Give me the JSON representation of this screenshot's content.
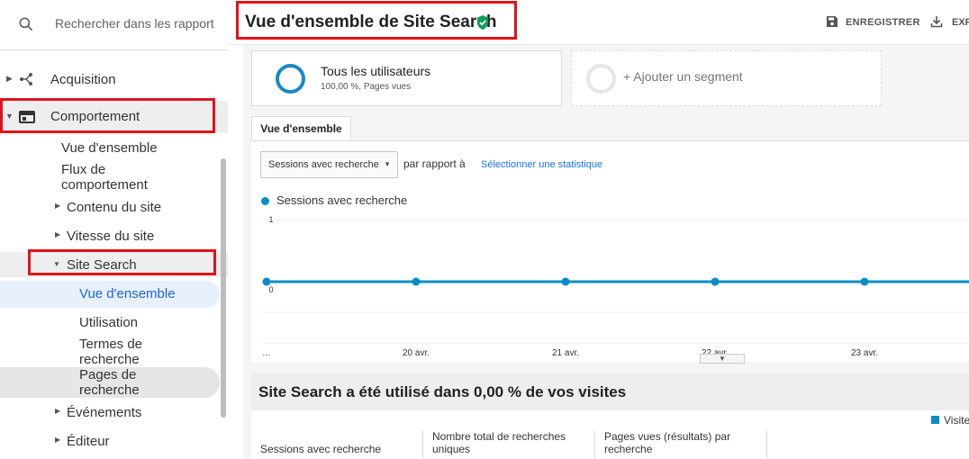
{
  "sidebar": {
    "search_placeholder": "Rechercher dans les rapport",
    "items": {
      "acquisition": "Acquisition",
      "comportement": "Comportement",
      "vue_ensemble": "Vue d'ensemble",
      "flux_comportement": "Flux de comportement",
      "contenu_site": "Contenu du site",
      "vitesse_site": "Vitesse du site",
      "site_search": "Site Search",
      "ss_vue_ensemble": "Vue d'ensemble",
      "ss_utilisation": "Utilisation",
      "ss_termes": "Termes de recherche",
      "ss_pages": "Pages de recherche",
      "evenements": "Événements",
      "editeur": "Éditeur"
    }
  },
  "header": {
    "title": "Vue d'ensemble de Site Search",
    "save_label": "ENREGISTRER",
    "export_label": "EXPORTER"
  },
  "segments": {
    "all_users_title": "Tous les utilisateurs",
    "all_users_sub": "100,00 %, Pages vues",
    "add_segment": "+ Ajouter un segment"
  },
  "tabs": {
    "overview": "Vue d'ensemble"
  },
  "controls": {
    "metric_select": "Sessions avec recherche",
    "compare_text": "par rapport à",
    "select_stat_link": "Sélectionner une statistique"
  },
  "chart_data": {
    "type": "line",
    "series": [
      {
        "name": "Sessions avec recherche",
        "values": [
          0,
          0,
          0,
          0,
          0,
          0
        ]
      }
    ],
    "x": [
      "…",
      "20 avr.",
      "21 avr.",
      "22 avr.",
      "23 avr.",
      ""
    ],
    "y_ticks": [
      "1",
      "0"
    ],
    "ylim": [
      0,
      1
    ],
    "grid": true,
    "color": "#058dc7"
  },
  "summary": {
    "title": "Site Search a été utilisé dans 0,00 % de vos visites",
    "legend": "Visites"
  },
  "metrics": {
    "sessions": "Sessions avec recherche",
    "total_searches": "Nombre total de recherches uniques",
    "pages_per_search": "Pages vues (résultats) par recherche"
  }
}
